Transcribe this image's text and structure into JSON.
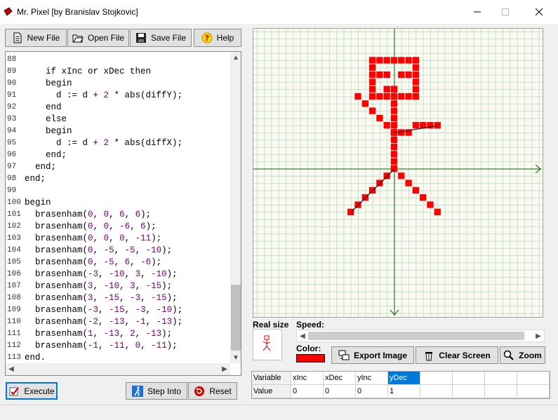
{
  "window": {
    "title": "Mr. Pixel [by Branislav Stojkovic]"
  },
  "toolbar": {
    "new_file": "New File",
    "open_file": "Open File",
    "save_file": "Save File",
    "help": "Help"
  },
  "editor": {
    "lines": [
      {
        "n": "88",
        "indent": "",
        "parts": []
      },
      {
        "n": "89",
        "indent": "    ",
        "parts": [
          {
            "t": "if xInc or xDec then"
          }
        ]
      },
      {
        "n": "90",
        "indent": "    ",
        "parts": [
          {
            "t": "begin"
          }
        ]
      },
      {
        "n": "91",
        "indent": "      ",
        "parts": [
          {
            "t": "d := d + "
          },
          {
            "t": "2",
            "num": true
          },
          {
            "t": " * abs(diffY);"
          }
        ]
      },
      {
        "n": "92",
        "indent": "    ",
        "parts": [
          {
            "t": "end"
          }
        ]
      },
      {
        "n": "93",
        "indent": "    ",
        "parts": [
          {
            "t": "else"
          }
        ]
      },
      {
        "n": "94",
        "indent": "    ",
        "parts": [
          {
            "t": "begin"
          }
        ]
      },
      {
        "n": "95",
        "indent": "      ",
        "parts": [
          {
            "t": "d := d + "
          },
          {
            "t": "2",
            "num": true
          },
          {
            "t": " * abs(diffX);"
          }
        ]
      },
      {
        "n": "96",
        "indent": "    ",
        "parts": [
          {
            "t": "end;"
          }
        ]
      },
      {
        "n": "97",
        "indent": "  ",
        "parts": [
          {
            "t": "end;"
          }
        ]
      },
      {
        "n": "98",
        "indent": "",
        "parts": [
          {
            "t": "end;"
          }
        ]
      },
      {
        "n": "99",
        "indent": "",
        "parts": []
      },
      {
        "n": "100",
        "indent": "",
        "parts": [
          {
            "t": "begin"
          }
        ]
      },
      {
        "n": "101",
        "indent": "  ",
        "parts": [
          {
            "t": "brasenham("
          },
          {
            "t": "0",
            "num": true
          },
          {
            "t": ", "
          },
          {
            "t": "0",
            "num": true
          },
          {
            "t": ", "
          },
          {
            "t": "6",
            "num": true
          },
          {
            "t": ", "
          },
          {
            "t": "6",
            "num": true
          },
          {
            "t": ");"
          }
        ]
      },
      {
        "n": "102",
        "indent": "  ",
        "parts": [
          {
            "t": "brasenham("
          },
          {
            "t": "0",
            "num": true
          },
          {
            "t": ", "
          },
          {
            "t": "0",
            "num": true
          },
          {
            "t": ", "
          },
          {
            "t": "-6",
            "num": true
          },
          {
            "t": ", "
          },
          {
            "t": "6",
            "num": true
          },
          {
            "t": ");"
          }
        ]
      },
      {
        "n": "103",
        "indent": "  ",
        "parts": [
          {
            "t": "brasenham("
          },
          {
            "t": "0",
            "num": true
          },
          {
            "t": ", "
          },
          {
            "t": "0",
            "num": true
          },
          {
            "t": ", "
          },
          {
            "t": "0",
            "num": true
          },
          {
            "t": ", "
          },
          {
            "t": "-11",
            "num": true
          },
          {
            "t": ");"
          }
        ]
      },
      {
        "n": "104",
        "indent": "  ",
        "parts": [
          {
            "t": "brasenham("
          },
          {
            "t": "0",
            "num": true
          },
          {
            "t": ", "
          },
          {
            "t": "-5",
            "num": true
          },
          {
            "t": ", "
          },
          {
            "t": "-5",
            "num": true
          },
          {
            "t": ", "
          },
          {
            "t": "-10",
            "num": true
          },
          {
            "t": ");"
          }
        ]
      },
      {
        "n": "105",
        "indent": "  ",
        "parts": [
          {
            "t": "brasenham("
          },
          {
            "t": "0",
            "num": true
          },
          {
            "t": ", "
          },
          {
            "t": "-5",
            "num": true
          },
          {
            "t": ", "
          },
          {
            "t": "6",
            "num": true
          },
          {
            "t": ", "
          },
          {
            "t": "-6",
            "num": true
          },
          {
            "t": ");"
          }
        ]
      },
      {
        "n": "106",
        "indent": "  ",
        "parts": [
          {
            "t": "brasenham("
          },
          {
            "t": "-3",
            "num": true
          },
          {
            "t": ", "
          },
          {
            "t": "-10",
            "num": true
          },
          {
            "t": ", "
          },
          {
            "t": "3",
            "num": true
          },
          {
            "t": ", "
          },
          {
            "t": "-10",
            "num": true
          },
          {
            "t": ");"
          }
        ]
      },
      {
        "n": "107",
        "indent": "  ",
        "parts": [
          {
            "t": "brasenham("
          },
          {
            "t": "3",
            "num": true
          },
          {
            "t": ", "
          },
          {
            "t": "-10",
            "num": true
          },
          {
            "t": ", "
          },
          {
            "t": "3",
            "num": true
          },
          {
            "t": ", "
          },
          {
            "t": "-15",
            "num": true
          },
          {
            "t": ");"
          }
        ]
      },
      {
        "n": "108",
        "indent": "  ",
        "parts": [
          {
            "t": "brasenham("
          },
          {
            "t": "3",
            "num": true
          },
          {
            "t": ", "
          },
          {
            "t": "-15",
            "num": true
          },
          {
            "t": ", "
          },
          {
            "t": "-3",
            "num": true
          },
          {
            "t": ", "
          },
          {
            "t": "-15",
            "num": true
          },
          {
            "t": ");"
          }
        ]
      },
      {
        "n": "109",
        "indent": "  ",
        "parts": [
          {
            "t": "brasenham("
          },
          {
            "t": "-3",
            "num": true
          },
          {
            "t": ", "
          },
          {
            "t": "-15",
            "num": true
          },
          {
            "t": ", "
          },
          {
            "t": "-3",
            "num": true
          },
          {
            "t": ", "
          },
          {
            "t": "-10",
            "num": true
          },
          {
            "t": ");"
          }
        ]
      },
      {
        "n": "110",
        "indent": "  ",
        "parts": [
          {
            "t": "brasenham("
          },
          {
            "t": "-2",
            "num": true
          },
          {
            "t": ", "
          },
          {
            "t": "-13",
            "num": true
          },
          {
            "t": ", "
          },
          {
            "t": "-1",
            "num": true
          },
          {
            "t": ", "
          },
          {
            "t": "-13",
            "num": true
          },
          {
            "t": ");"
          }
        ]
      },
      {
        "n": "111",
        "indent": "  ",
        "parts": [
          {
            "t": "brasenham("
          },
          {
            "t": "1",
            "num": true
          },
          {
            "t": ", "
          },
          {
            "t": "-13",
            "num": true
          },
          {
            "t": ", "
          },
          {
            "t": "2",
            "num": true
          },
          {
            "t": ", "
          },
          {
            "t": "-13",
            "num": true
          },
          {
            "t": ");"
          }
        ]
      },
      {
        "n": "112",
        "indent": "  ",
        "parts": [
          {
            "t": "brasenham("
          },
          {
            "t": "-1",
            "num": true
          },
          {
            "t": ", "
          },
          {
            "t": "-11",
            "num": true
          },
          {
            "t": ", "
          },
          {
            "t": "0",
            "num": true
          },
          {
            "t": ", "
          },
          {
            "t": "-11",
            "num": true
          },
          {
            "t": ");"
          }
        ]
      },
      {
        "n": "113",
        "indent": "",
        "parts": [
          {
            "t": "end."
          }
        ]
      }
    ]
  },
  "bottom": {
    "execute": "Execute",
    "step_into": "Step Into",
    "reset": "Reset"
  },
  "panel": {
    "real_size_label": "Real size",
    "speed_label": "Speed:",
    "color_label": "Color:",
    "export_image": "Export Image",
    "clear_screen": "Clear Screen",
    "zoom": "Zoom",
    "pixel_color": "#ff0000",
    "axis_color": "#006400",
    "grid_color": "#c8e0c8"
  },
  "variables": {
    "header_label": "Variable",
    "value_label": "Value",
    "columns": [
      "xInc",
      "xDec",
      "yInc",
      "yDec"
    ],
    "values": [
      "0",
      "0",
      "0",
      "1"
    ],
    "selected": "yDec"
  }
}
